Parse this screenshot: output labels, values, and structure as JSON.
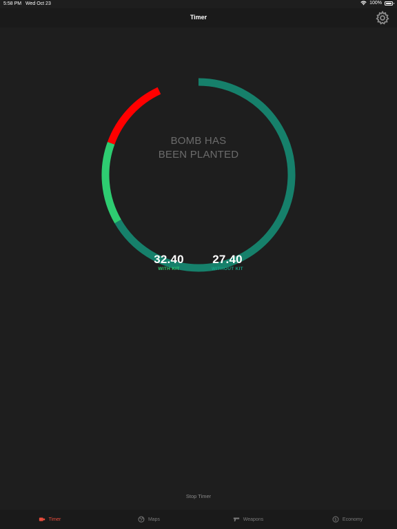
{
  "status_bar": {
    "time": "5:58 PM",
    "date": "Wed Oct 23",
    "battery": "100%"
  },
  "nav": {
    "title": "Timer"
  },
  "ring": {
    "text_line1": "BOMB HAS",
    "text_line2": "BEEN PLANTED",
    "colors": {
      "track": "#16806b",
      "with_kit": "#2ecc71",
      "danger": "#ff0000"
    }
  },
  "times": {
    "with_kit_value": "32.40",
    "with_kit_label": "WITH KIT",
    "without_kit_value": "27.40",
    "without_kit_label": "WITHOUT KIT"
  },
  "actions": {
    "stop_label": "Stop Timer"
  },
  "tabs": [
    {
      "label": "Timer",
      "icon": "bomb-icon",
      "active": true
    },
    {
      "label": "Maps",
      "icon": "globe-icon",
      "active": false
    },
    {
      "label": "Weapons",
      "icon": "gun-icon",
      "active": false
    },
    {
      "label": "Economy",
      "icon": "dollar-icon",
      "active": false
    }
  ],
  "accent_colors": {
    "active_tab": "#e74c3c",
    "with_kit": "#2ecc71",
    "without_kit": "#16a085"
  }
}
